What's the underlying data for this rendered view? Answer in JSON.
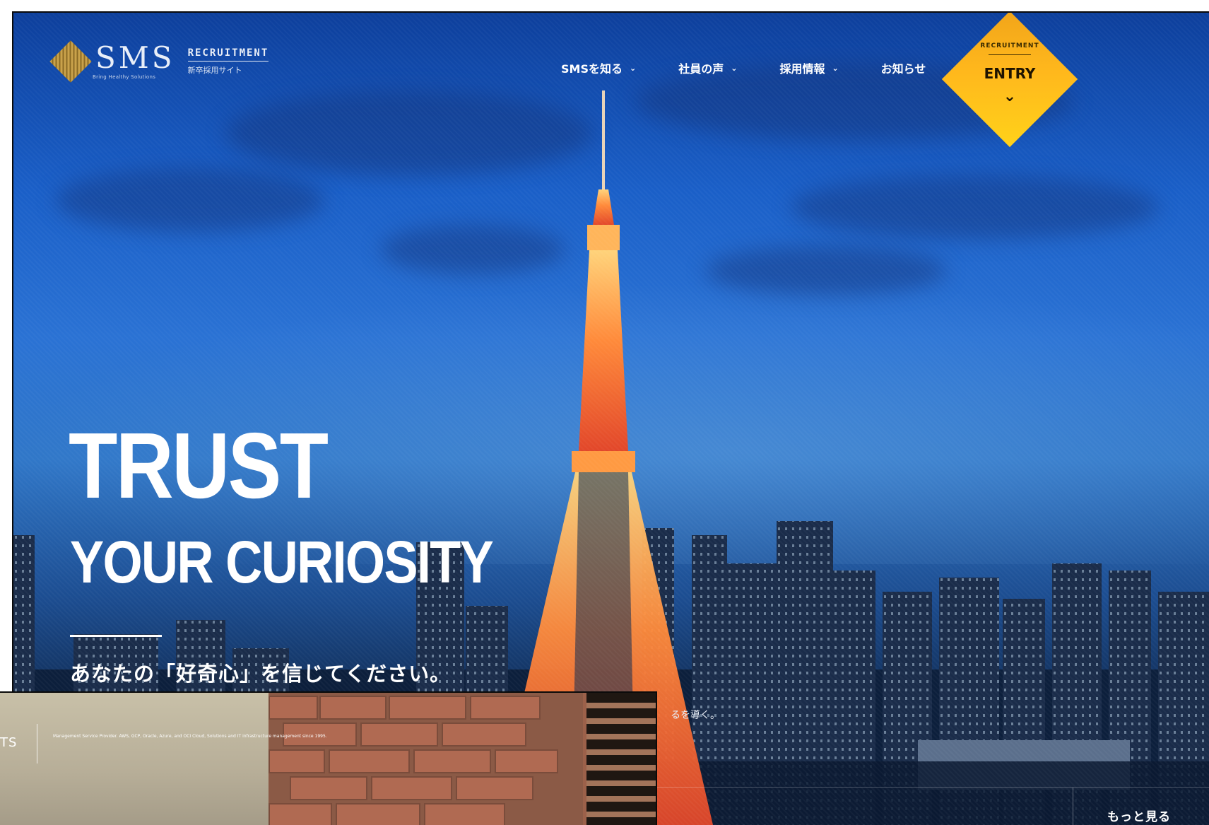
{
  "header": {
    "logo_word": "SMS",
    "logo_tagline": "Bring Healthy Solutions",
    "recruitment": "RECRUITMENT",
    "site_name": "新卒採用サイト"
  },
  "nav": {
    "items": [
      {
        "label": "SMSを知る",
        "chevron": "⌄"
      },
      {
        "label": "社員の声",
        "chevron": "⌄"
      },
      {
        "label": "採用情報",
        "chevron": "⌄"
      },
      {
        "label": "お知らせ"
      }
    ]
  },
  "entry": {
    "top": "RECRUITMENT",
    "label": "ENTRY",
    "arrow": "⌄"
  },
  "hero": {
    "headline_1": "TRUST",
    "headline_2": "YOUR CURIOSITY",
    "subcopy": "あなたの「好奇心」を信じてください。",
    "partial_text": "るを導く。",
    "more": "もっと見る"
  },
  "overlay": {
    "label": "TS",
    "text": "Management Service Provider. AWS, GCP, Oracle, Azure, and OCI Cloud, Solutions and IT infrastructure management since 1995."
  }
}
